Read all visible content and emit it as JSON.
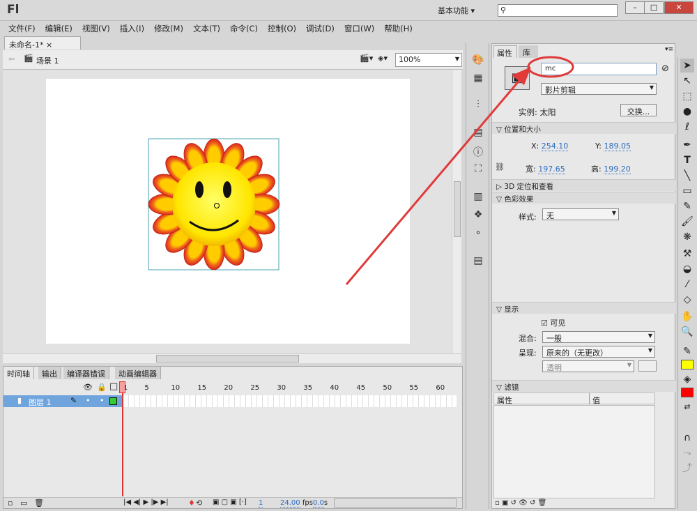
{
  "app": {
    "logo": "Fl",
    "workspace": "基本功能",
    "search_placeholder": ""
  },
  "menu": [
    "文件(F)",
    "编辑(E)",
    "视图(V)",
    "插入(I)",
    "修改(M)",
    "文本(T)",
    "命令(C)",
    "控制(O)",
    "调试(D)",
    "窗口(W)",
    "帮助(H)"
  ],
  "document": {
    "tab": "未命名-1*",
    "close": "×",
    "scene": "场景 1",
    "zoom": "100%"
  },
  "timeline": {
    "tabs": [
      "时间轴",
      "输出",
      "编译器错误",
      "动画编辑器"
    ],
    "frame_numbers": [
      "1",
      "5",
      "10",
      "15",
      "20",
      "25",
      "30",
      "35",
      "40",
      "45",
      "50",
      "55",
      "60"
    ],
    "layer": "图层 1",
    "current_frame": "1",
    "fps": "24.00",
    "fps_unit": "fps",
    "time": "0.0",
    "time_unit": "s"
  },
  "properties": {
    "tabs": [
      "属性",
      "库"
    ],
    "instance_name": "mc",
    "symbol_type": "影片剪辑",
    "instance_label": "实例:",
    "instance_value": "太阳",
    "swap_button": "交换...",
    "sections": {
      "position": "位置和大小",
      "threed": "3D 定位和查看",
      "color": "色彩效果",
      "display": "显示",
      "filters": "滤镜"
    },
    "x_label": "X:",
    "x": "254.10",
    "y_label": "Y:",
    "y": "189.05",
    "w_label": "宽:",
    "w": "197.65",
    "h_label": "高:",
    "h": "199.20",
    "style_label": "样式:",
    "style_value": "无",
    "visible_label": "可见",
    "blend_label": "混合:",
    "blend_value": "一般",
    "render_label": "呈现:",
    "render_value": "原来的（无更改）",
    "transparent_value": "透明",
    "filter_cols": [
      "属性",
      "值"
    ]
  },
  "colors": {
    "annotation": "#e03a3a",
    "stroke": "#ffff00",
    "fill": "#ff0000",
    "layer_highlight": "#6fa4dd"
  }
}
